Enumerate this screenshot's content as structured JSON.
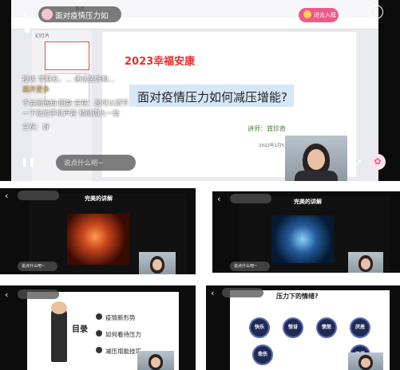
{
  "main": {
    "room_title": "面对疫情压力如",
    "enter_button": "进去入框",
    "slide_heading": "2023幸福安康",
    "slide_title": "面对疫情压力如何减压增能?",
    "speaker": "讲师：龚珍奇",
    "date": "2022年1月5日",
    "toolbar_label": "首页",
    "pane_label": "幻灯片",
    "chat": [
      {
        "user": "投诉",
        "text": "学朋友，… 通话装饰和…"
      },
      {
        "user": "",
        "text": "展开更多"
      },
      {
        "user": "不会画画知",
        "text": "回复 兰花：您可以调节一下您的手机声音 稍微调大一些"
      },
      {
        "user": "兰花",
        "text": "好"
      }
    ],
    "comment_placeholder": "说点什么吧~",
    "accent": "#f2557a"
  },
  "thumb1": {
    "title": "完美的讲解",
    "placeholder": "说点什么吧~"
  },
  "thumb2": {
    "title": "完美的讲解",
    "placeholder": "说点什么吧~"
  },
  "thumb3": {
    "items": [
      "疫情新形势",
      "如何看待压力",
      "减压增能技巧"
    ],
    "side": "目录"
  },
  "thumb4": {
    "title": "压力下的情绪?",
    "emotions": [
      "快乐",
      "惊讶",
      "愤怒",
      "厌恶",
      "悲伤",
      "恐惧"
    ]
  }
}
